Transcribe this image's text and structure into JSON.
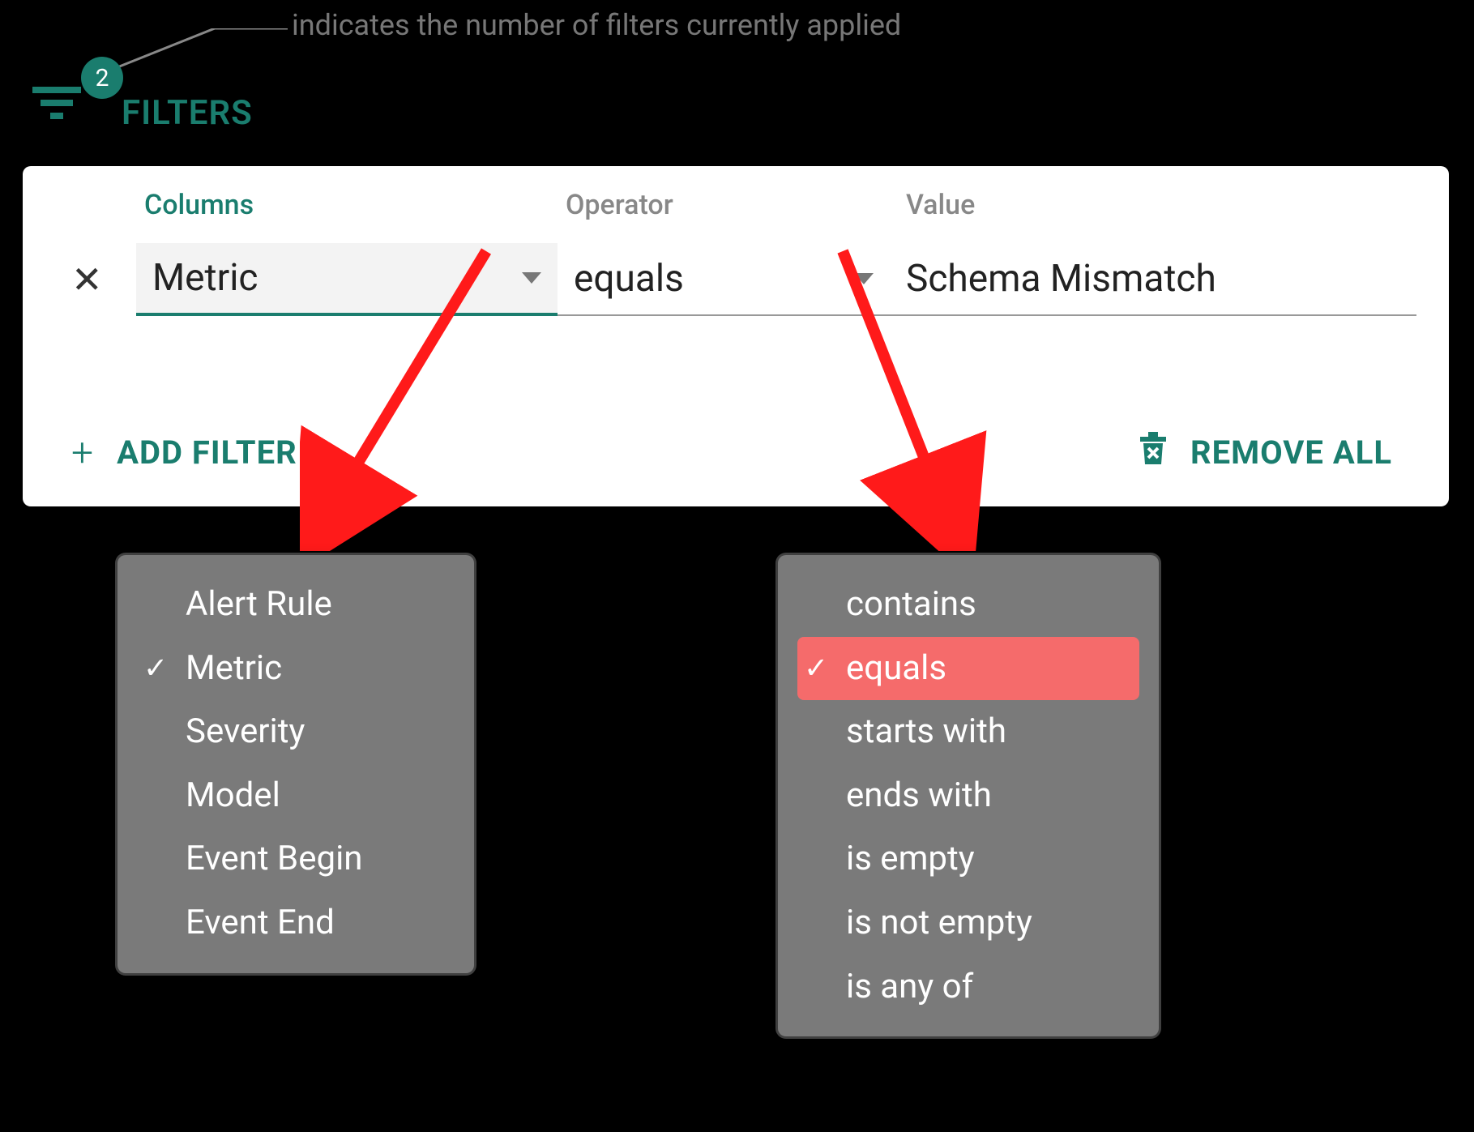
{
  "annotation": {
    "text": "indicates the number of filters currently applied"
  },
  "filters": {
    "label": "FILTERS",
    "badge_count": "2"
  },
  "panel": {
    "labels": {
      "columns": "Columns",
      "operator": "Operator",
      "value": "Value"
    },
    "row": {
      "column": "Metric",
      "operator": "equals",
      "value": "Schema Mismatch"
    },
    "add_filter_label": "ADD FILTER",
    "remove_all_label": "REMOVE ALL"
  },
  "columns_dropdown": {
    "items": [
      {
        "label": "Alert Rule",
        "selected": false
      },
      {
        "label": "Metric",
        "selected": true
      },
      {
        "label": "Severity",
        "selected": false
      },
      {
        "label": "Model",
        "selected": false
      },
      {
        "label": "Event Begin",
        "selected": false
      },
      {
        "label": "Event End",
        "selected": false
      }
    ]
  },
  "operators_dropdown": {
    "items": [
      {
        "label": "contains",
        "selected": false
      },
      {
        "label": "equals",
        "selected": true
      },
      {
        "label": "starts with",
        "selected": false
      },
      {
        "label": "ends with",
        "selected": false
      },
      {
        "label": "is empty",
        "selected": false
      },
      {
        "label": "is not empty",
        "selected": false
      },
      {
        "label": "is any of",
        "selected": false
      }
    ]
  }
}
